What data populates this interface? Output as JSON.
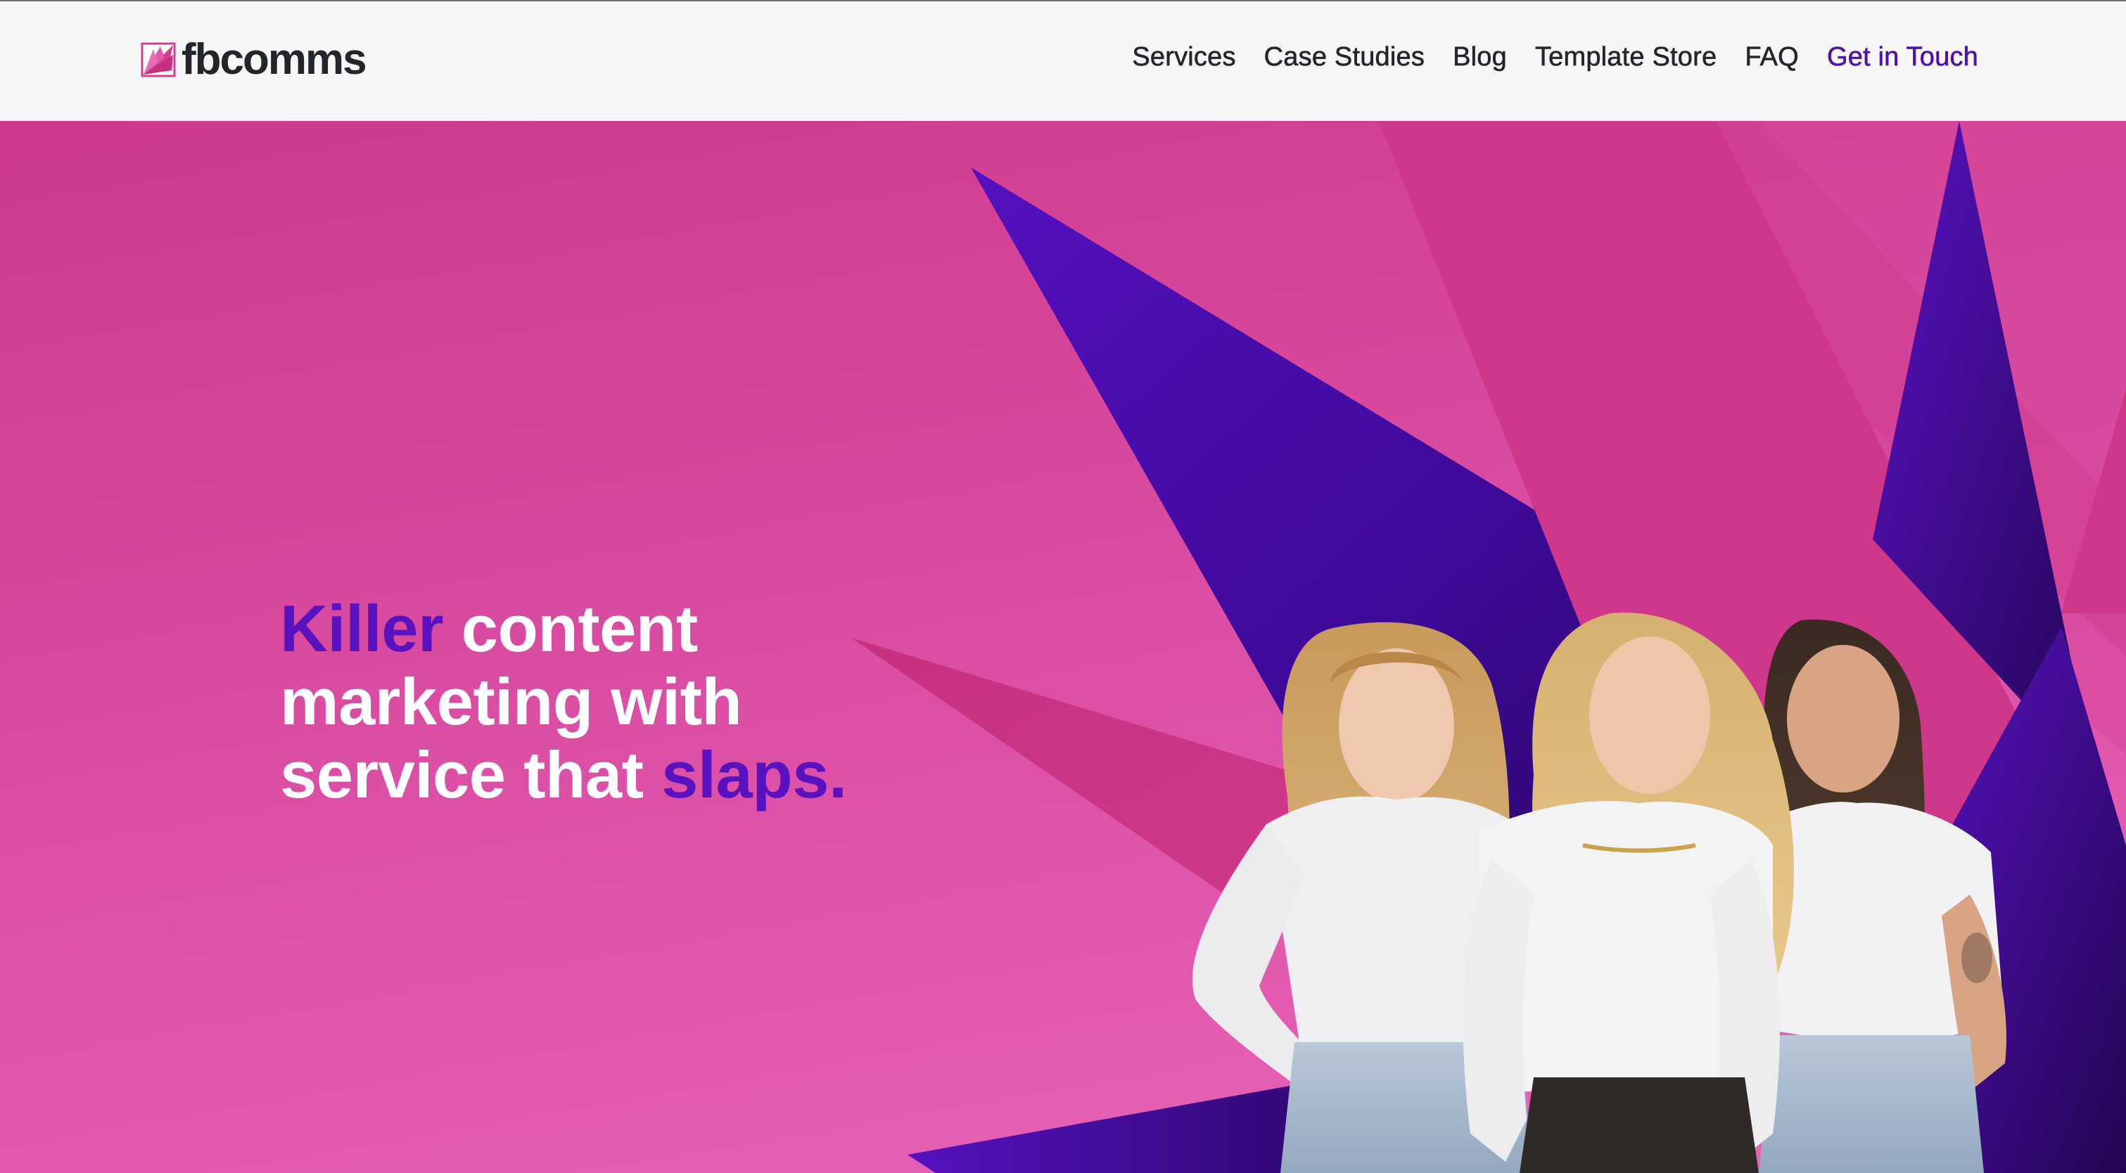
{
  "brand": {
    "name": "fbcomms",
    "colors": {
      "pink": "#d94ca2",
      "purple": "#4d10ad",
      "dark": "#22262b",
      "nav_bg": "#f6f6f6"
    }
  },
  "nav": {
    "items": [
      {
        "label": "Services"
      },
      {
        "label": "Case Studies"
      },
      {
        "label": "Blog"
      },
      {
        "label": "Template Store"
      },
      {
        "label": "FAQ"
      },
      {
        "label": "Get in Touch"
      }
    ]
  },
  "hero": {
    "headline": {
      "word1": "Killer",
      "line1_rest": " content",
      "line2": "marketing with",
      "line3_start": "service that ",
      "word_accent": "slaps."
    },
    "image": {
      "icon": "team-photo",
      "description_people": 3
    }
  },
  "icons": {
    "logo": "fbcomms-logo-icon"
  }
}
